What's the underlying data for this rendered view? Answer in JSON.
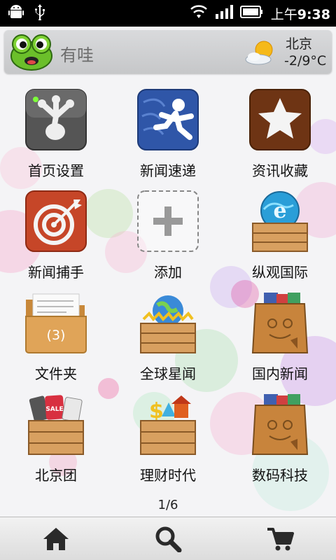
{
  "status_bar": {
    "time_prefix": "上午",
    "time": "9:38"
  },
  "header": {
    "app_name": "有哇",
    "weather": {
      "city": "北京",
      "temperature": "-2/9°C",
      "icon": "sun-cloud-icon"
    }
  },
  "grid": {
    "items": [
      {
        "label": "首页设置",
        "icon": "frog-foot-icon"
      },
      {
        "label": "新闻速递",
        "icon": "runner-icon"
      },
      {
        "label": "资讯收藏",
        "icon": "star-icon"
      },
      {
        "label": "新闻捕手",
        "icon": "target-icon"
      },
      {
        "label": "添加",
        "icon": "plus-icon"
      },
      {
        "label": "纵观国际",
        "icon": "globe-crate-icon"
      },
      {
        "label": "文件夹",
        "icon": "folder-icon",
        "badge": "(3)"
      },
      {
        "label": "全球星闻",
        "icon": "earth-crate-icon"
      },
      {
        "label": "国内新闻",
        "icon": "frog-box-icon"
      },
      {
        "label": "北京团",
        "icon": "shopping-crate-icon"
      },
      {
        "label": "理财时代",
        "icon": "finance-crate-icon"
      },
      {
        "label": "数码科技",
        "icon": "frog-box-icon"
      }
    ]
  },
  "pager": {
    "text": "1/6"
  },
  "bottom_bar": {
    "buttons": [
      "home-icon",
      "search-icon",
      "cart-icon"
    ]
  },
  "colors": {
    "status_bar_bg": "#000000",
    "header_bg": "#cfd0d2",
    "bottom_bar_bg": "#e6e6e6"
  }
}
